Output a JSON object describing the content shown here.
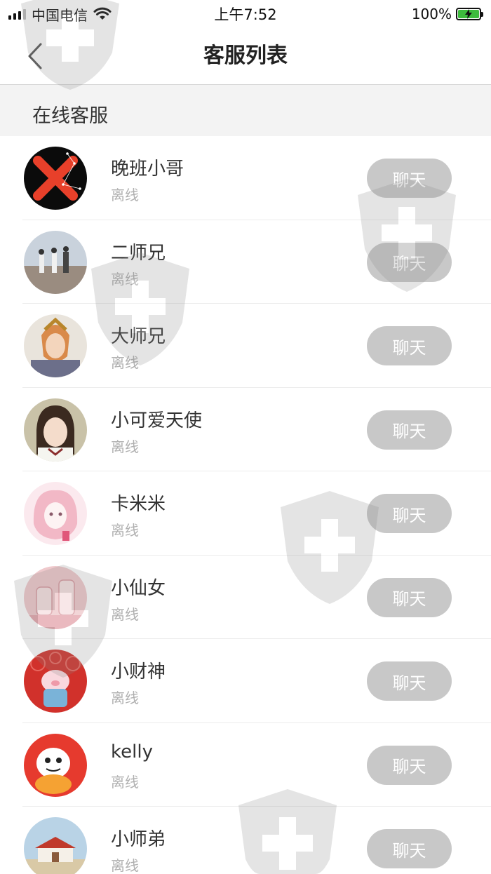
{
  "status_bar": {
    "carrier": "中国电信",
    "time": "上午7:52",
    "battery": "100%"
  },
  "nav": {
    "title": "客服列表"
  },
  "section": {
    "title": "在线客服"
  },
  "agents": [
    {
      "name": "晚班小哥",
      "status": "离线",
      "button": "聊天"
    },
    {
      "name": "二师兄",
      "status": "离线",
      "button": "聊天"
    },
    {
      "name": "大师兄",
      "status": "离线",
      "button": "聊天"
    },
    {
      "name": "小可爱天使",
      "status": "离线",
      "button": "聊天"
    },
    {
      "name": "卡米米",
      "status": "离线",
      "button": "聊天"
    },
    {
      "name": "小仙女",
      "status": "离线",
      "button": "聊天"
    },
    {
      "name": "小财神",
      "status": "离线",
      "button": "聊天"
    },
    {
      "name": "kelly",
      "status": "离线",
      "button": "聊天"
    },
    {
      "name": "小师弟",
      "status": "离线",
      "button": "聊天"
    }
  ],
  "colors": {
    "button_bg": "#c8c8c8",
    "section_bg": "#f3f3f3",
    "offline_text": "#b0b0b0",
    "battery_fill": "#3dbb3d"
  }
}
